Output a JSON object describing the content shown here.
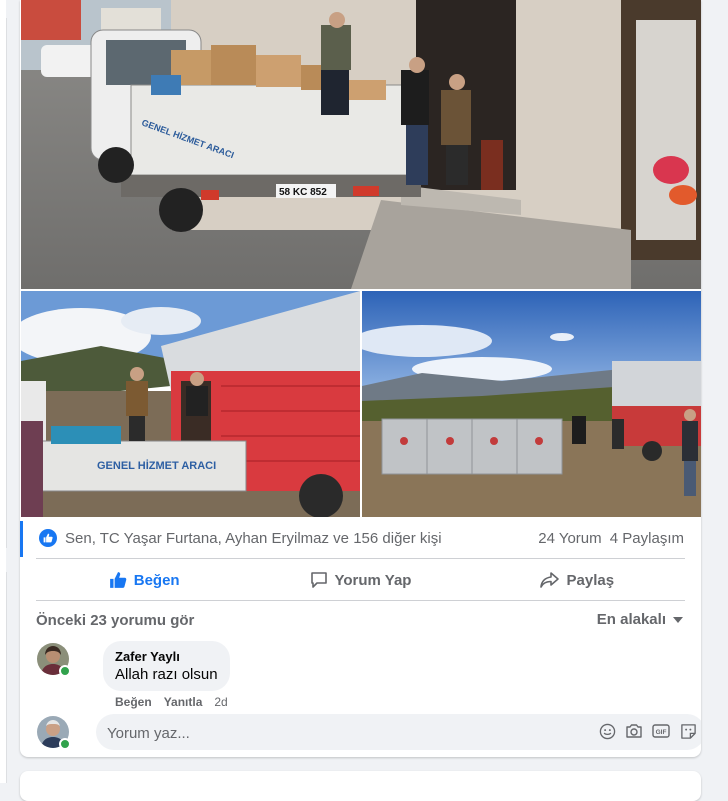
{
  "post": {
    "photos": [
      {
        "name": "photo-truck-unloading",
        "truck_door_text": "GENEL HİZMET ARACI",
        "plate": "58 KC 852"
      },
      {
        "name": "photo-red-truck",
        "truck_door_text": "GENEL HİZMET ARACI"
      },
      {
        "name": "photo-containers-field"
      }
    ],
    "reactions_text": "Sen, TC Yaşar Furtana, Ayhan Eryilmaz ve 156 diğer kişi",
    "comment_count": "24 Yorum",
    "share_count": "4 Paylaşım",
    "actions": {
      "like": "Beğen",
      "comment": "Yorum Yap",
      "share": "Paylaş"
    }
  },
  "comments": {
    "previous_label": "Önceki 23 yorumu gör",
    "sort_label": "En alakalı",
    "items": [
      {
        "author": "Zafer Yaylı",
        "text": "Allah razı olsun",
        "like": "Beğen",
        "reply": "Yanıtla",
        "time": "2d"
      }
    ],
    "composer_placeholder": "Yorum yaz..."
  },
  "colors": {
    "accent": "#1877f2",
    "secondary_text": "#65676b",
    "online": "#31a24c"
  },
  "icons": [
    "like-icon",
    "comment-icon",
    "share-icon",
    "chevron-down-icon",
    "emoji-icon",
    "camera-icon",
    "gif-icon",
    "sticker-icon"
  ]
}
